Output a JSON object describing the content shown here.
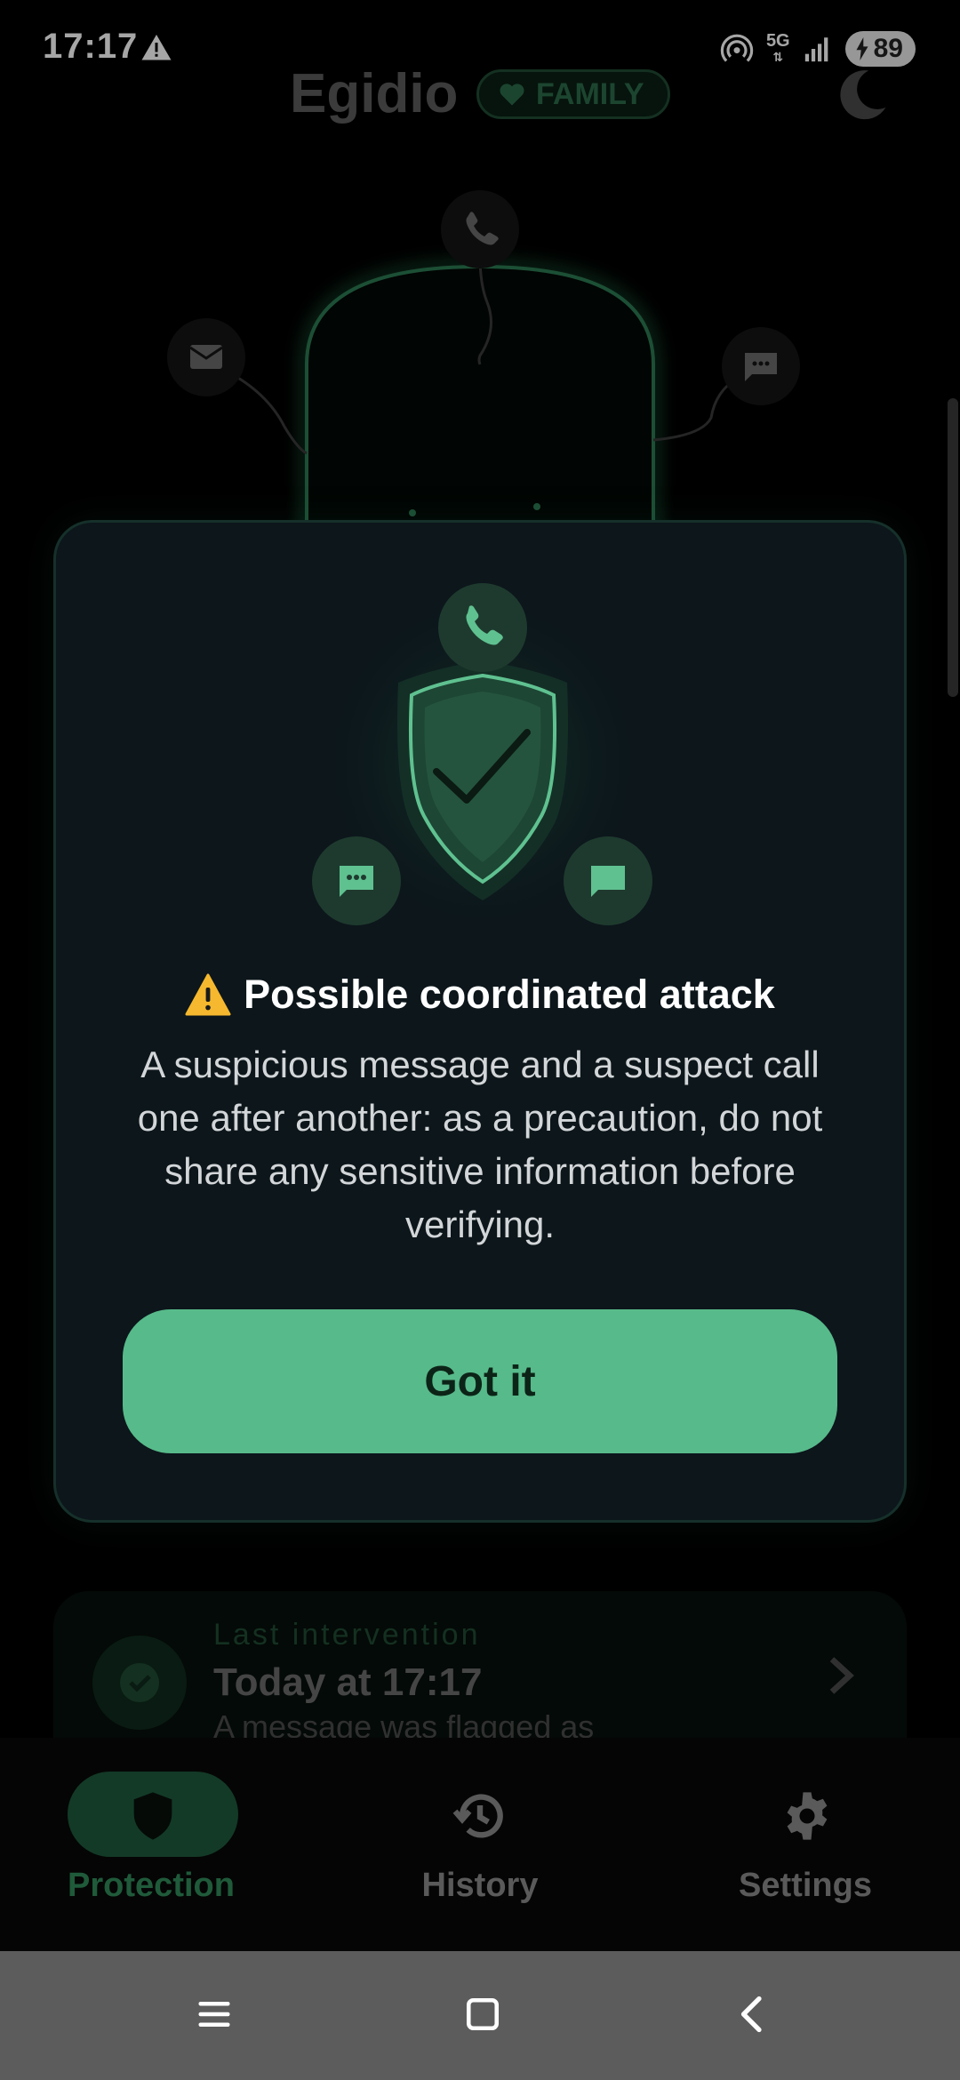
{
  "status_bar": {
    "time": "17:17",
    "network": "5G",
    "battery": "89"
  },
  "header": {
    "app_title": "Egidio",
    "badge": "FAMILY"
  },
  "dialog": {
    "title": "Possible coordinated attack",
    "body": "A suspicious message and a suspect call one after another: as a precaution, do not share any sensitive information before verifying.",
    "button": "Got it"
  },
  "last_intervention": {
    "label": "Last intervention",
    "time": "Today at 17:17",
    "description": "A message was flagged as"
  },
  "bottom_nav": {
    "items": [
      {
        "label": "Protection",
        "icon": "shield-icon",
        "active": true
      },
      {
        "label": "History",
        "icon": "history-icon",
        "active": false
      },
      {
        "label": "Settings",
        "icon": "gear-icon",
        "active": false
      }
    ]
  },
  "colors": {
    "accent": "#57ba8a",
    "dialog_bg": "#0c161b",
    "nav_active_pill": "#133a27"
  }
}
